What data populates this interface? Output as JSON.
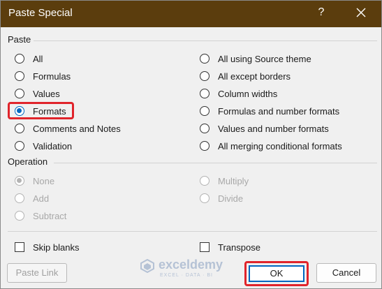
{
  "window": {
    "title": "Paste Special",
    "help_label": "?"
  },
  "paste": {
    "heading": "Paste",
    "left": [
      {
        "label": "All",
        "selected": false
      },
      {
        "label": "Formulas",
        "selected": false
      },
      {
        "label": "Values",
        "selected": false
      },
      {
        "label": "Formats",
        "selected": true
      },
      {
        "label": "Comments and Notes",
        "selected": false
      },
      {
        "label": "Validation",
        "selected": false
      }
    ],
    "right": [
      {
        "label": "All using Source theme",
        "selected": false
      },
      {
        "label": "All except borders",
        "selected": false
      },
      {
        "label": "Column widths",
        "selected": false
      },
      {
        "label": "Formulas and number formats",
        "selected": false
      },
      {
        "label": "Values and number formats",
        "selected": false
      },
      {
        "label": "All merging conditional formats",
        "selected": false
      }
    ]
  },
  "operation": {
    "heading": "Operation",
    "left": [
      {
        "label": "None",
        "selected": true
      },
      {
        "label": "Add",
        "selected": false
      },
      {
        "label": "Subtract",
        "selected": false
      }
    ],
    "right": [
      {
        "label": "Multiply",
        "selected": false
      },
      {
        "label": "Divide",
        "selected": false
      }
    ]
  },
  "options": {
    "skip_blanks": {
      "label": "Skip blanks",
      "checked": false
    },
    "transpose": {
      "label": "Transpose",
      "checked": false
    }
  },
  "buttons": {
    "paste_link": "Paste Link",
    "ok": "OK",
    "cancel": "Cancel"
  },
  "watermark": {
    "name": "exceldemy",
    "tagline": "EXCEL · DATA · BI"
  },
  "colors": {
    "titlebar": "#5b3d0d",
    "accent": "#0067c0",
    "highlight": "#e0242b"
  }
}
